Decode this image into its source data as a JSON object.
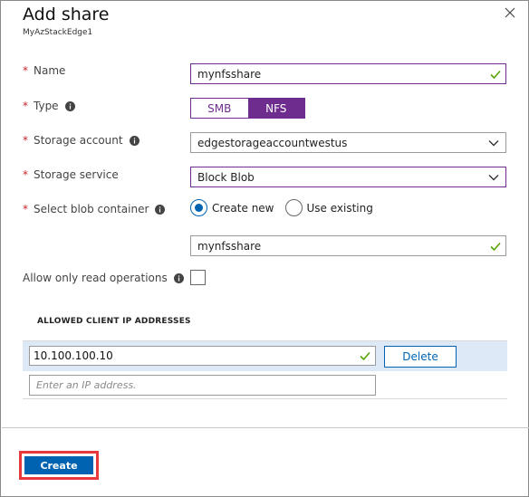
{
  "header": {
    "title": "Add share",
    "subtitle": "MyAzStackEdge1",
    "close_icon": "close-icon"
  },
  "form": {
    "required_marker": "*",
    "name": {
      "label": "Name",
      "value": "mynfsshare"
    },
    "type": {
      "label": "Type",
      "options": [
        "SMB",
        "NFS"
      ],
      "selected": "NFS"
    },
    "storage_account": {
      "label": "Storage account",
      "value": "edgestorageaccountwestus"
    },
    "storage_service": {
      "label": "Storage service",
      "value": "Block Blob"
    },
    "blob_container": {
      "label": "Select blob container",
      "options": [
        "Create new",
        "Use existing"
      ],
      "selected": "Create new",
      "value": "mynfsshare"
    },
    "read_only": {
      "label": "Allow only read operations",
      "checked": false
    }
  },
  "allowed_ips": {
    "heading": "ALLOWED CLIENT IP ADDRESSES",
    "entries": [
      "10.100.100.10"
    ],
    "delete_label": "Delete",
    "placeholder": "Enter an IP address."
  },
  "footer": {
    "create_label": "Create"
  },
  "colors": {
    "accent_purple": "#6e2c8f",
    "primary_blue": "#0063b1",
    "success_green": "#57a300",
    "required_red": "#c4262e",
    "highlight_red": "#e8383d",
    "row_highlight": "#dde9f6"
  }
}
